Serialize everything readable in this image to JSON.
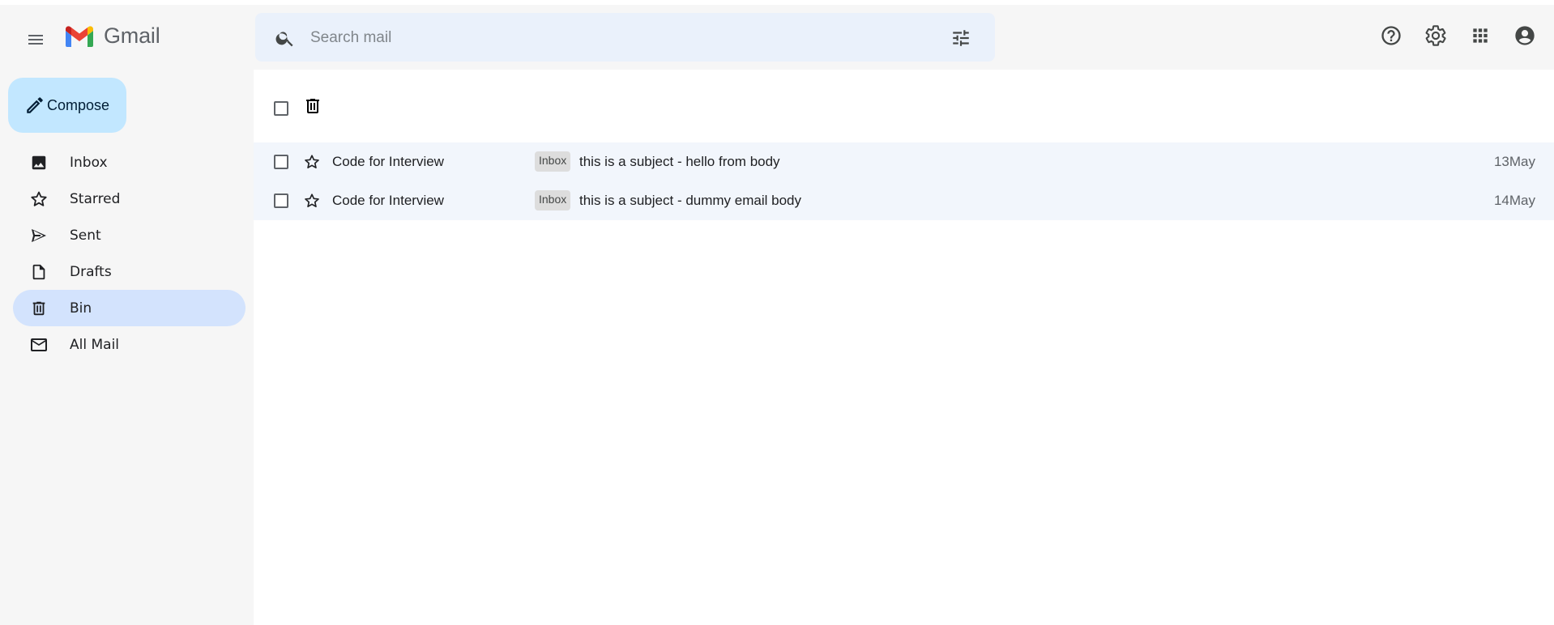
{
  "app": {
    "brand_name": "Gmail"
  },
  "search": {
    "placeholder": "Search mail"
  },
  "header_icons": [
    "help-icon",
    "settings-icon",
    "apps-grid-icon",
    "account-icon"
  ],
  "compose": {
    "label": "Compose"
  },
  "sidebar": {
    "active": "Bin",
    "items": [
      {
        "label": "Inbox",
        "icon": "inbox-image-icon"
      },
      {
        "label": "Starred",
        "icon": "star-outline-icon"
      },
      {
        "label": "Sent",
        "icon": "send-icon"
      },
      {
        "label": "Drafts",
        "icon": "draft-file-icon"
      },
      {
        "label": "Bin",
        "icon": "trash-icon"
      },
      {
        "label": "All Mail",
        "icon": "mail-icon"
      }
    ]
  },
  "emails": [
    {
      "sender": "Code for Interview",
      "label": "Inbox",
      "subject": "this is a subject - hello from body",
      "date": "13May"
    },
    {
      "sender": "Code for Interview",
      "label": "Inbox",
      "subject": "this is a subject - dummy email body",
      "date": "14May"
    }
  ],
  "colors": {
    "accent": "#c2e7ff",
    "active_nav": "#d3e3fd",
    "search_bg": "#eaf1fb",
    "row_bg": "#f2f6fc"
  }
}
